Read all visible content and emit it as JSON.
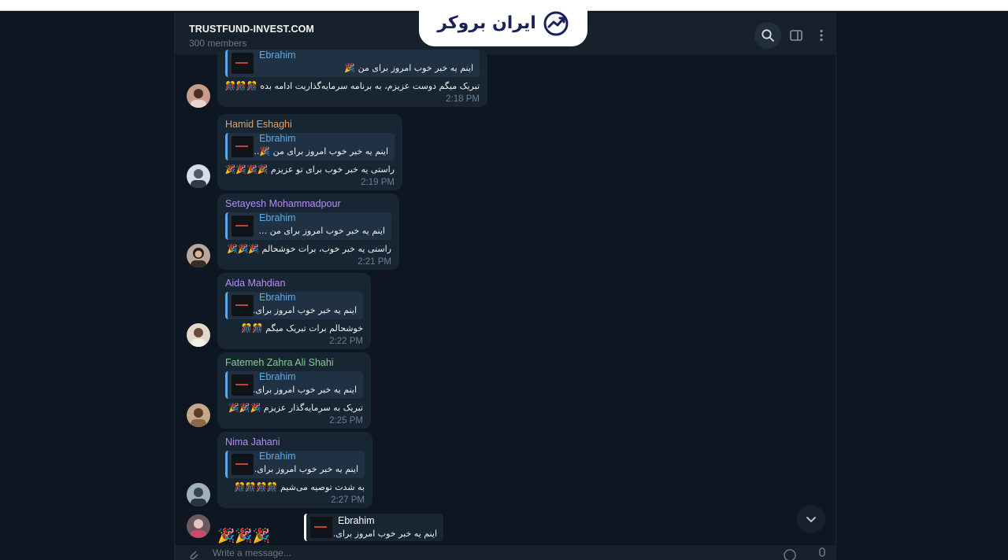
{
  "header": {
    "title": "TRUSTFUND-INVEST.COM",
    "subtitle": "300 members",
    "brand": "ایران بروکر"
  },
  "messages": [
    {
      "sender": "",
      "sender_color": "#8ec0f0",
      "reply_name": "Ebrahim",
      "reply_text": "اینم یه خبر خوب امروز برای من 🎉",
      "text": "تبریک میگم دوست عزیزم، به برنامه سرمایه‌گذاریت ادامه بده 🎊🎊🎊",
      "time": "2:18 PM"
    },
    {
      "sender": "Hamid Eshaghi",
      "sender_color": "#e6a05a",
      "reply_name": "Ebrahim",
      "reply_text": "اینم یه خبر خوب امروز برای من 🎉...",
      "text": "راستی یه خبر خوب برای تو عزیزم 🎉🎉🎉🎉",
      "time": "2:19 PM"
    },
    {
      "sender": "Setayesh Mohammadpour",
      "sender_color": "#b490f5",
      "reply_name": "Ebrahim",
      "reply_text": "اینم یه خبر خوب امروز برای من ...",
      "text": "راستی یه خبر خوب، برات خوشحالم 🎉🎉🎉",
      "time": "2:21 PM"
    },
    {
      "sender": "Aida Mahdian",
      "sender_color": "#b490f5",
      "reply_name": "Ebrahim",
      "reply_text": "اینم یه خبر خوب امروز برای...",
      "text": "خوشحالم برات تبریک میگم 🎊🎊",
      "time": "2:22 PM"
    },
    {
      "sender": "Fatemeh Zahra Ali Shahi",
      "sender_color": "#7dd388",
      "reply_name": "Ebrahim",
      "reply_text": "اینم یه خبر خوب امروز برای...",
      "text": "تبریک به سرمایه‌گذار عزیزم 🎉🎉🎉",
      "time": "2:25 PM"
    },
    {
      "sender": "Nima Jahani",
      "sender_color": "#b490f5",
      "reply_name": "Ebrahim",
      "reply_text": "اینم یه خبر خوب امروز برای...",
      "text": "به شدت توصیه می‌شیم 🎊🎊🎊🎊",
      "time": "2:27 PM"
    }
  ],
  "last_message": {
    "reply_name": "Ebrahim",
    "reply_text": "اینم یه خبر خوب امروز برای...",
    "sticker": "🎉🎉🎉"
  },
  "composer": {
    "placeholder": "Write a message..."
  },
  "colors": {
    "accent": "#5ea9e6",
    "bubble": "#182533",
    "background": "#0e1621"
  }
}
